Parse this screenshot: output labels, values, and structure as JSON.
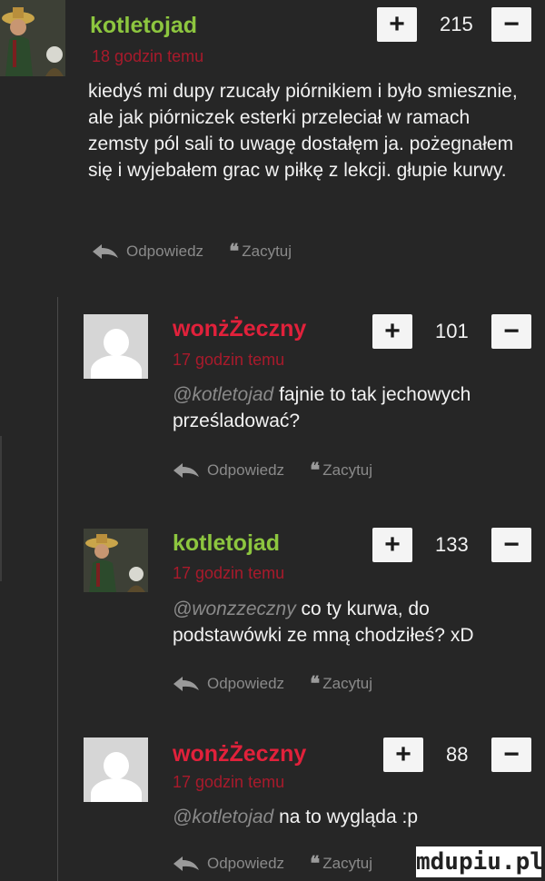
{
  "comments": [
    {
      "username": "kotletojad",
      "time": "18 godzin temu",
      "text": "kiedyś mi dupy rzucały piórnikiem i było smiesznie, ale jak piórniczek esterki przeleciał w ramach zemsty pól sali to uwagę dostałęm ja. pożegnałem się i wyjebałem grac w piłkę z lekcji. głupie kurwy.",
      "votes": "215",
      "avatar": "knight-avatar"
    },
    {
      "username": "wonżŻeczny",
      "time": "17 godzin temu",
      "mention": "@kotletojad",
      "text": "fajnie to tak jechowych prześladować?",
      "votes": "101",
      "avatar": "default-user-avatar"
    },
    {
      "username": "kotletojad",
      "time": "17 godzin temu",
      "mention": "@wonzzeczny",
      "text": "co ty kurwa, do podstawówki ze mną chodziłeś? xD",
      "votes": "133",
      "avatar": "knight-avatar"
    },
    {
      "username": "wonżŻeczny",
      "time": "17 godzin temu",
      "mention": "@kotletojad",
      "text": "na to wygląda :p",
      "votes": "88",
      "avatar": "default-user-avatar"
    }
  ],
  "actions": {
    "reply_label": "Odpowiedz",
    "quote_label": "Zacytuj"
  },
  "vote": {
    "plus": "+",
    "minus": "−"
  },
  "watermark": "mdupiu.pl",
  "colors": {
    "background": "#262626",
    "username_green": "#8dc63f",
    "username_red": "#e1213b",
    "time_red": "#c0182d",
    "muted": "#8a8a8a"
  },
  "icons": {
    "reply": "reply-arrow-icon",
    "quote": "quote-icon",
    "avatar_default": "default-user-avatar",
    "avatar_knight": "knight-avatar"
  }
}
